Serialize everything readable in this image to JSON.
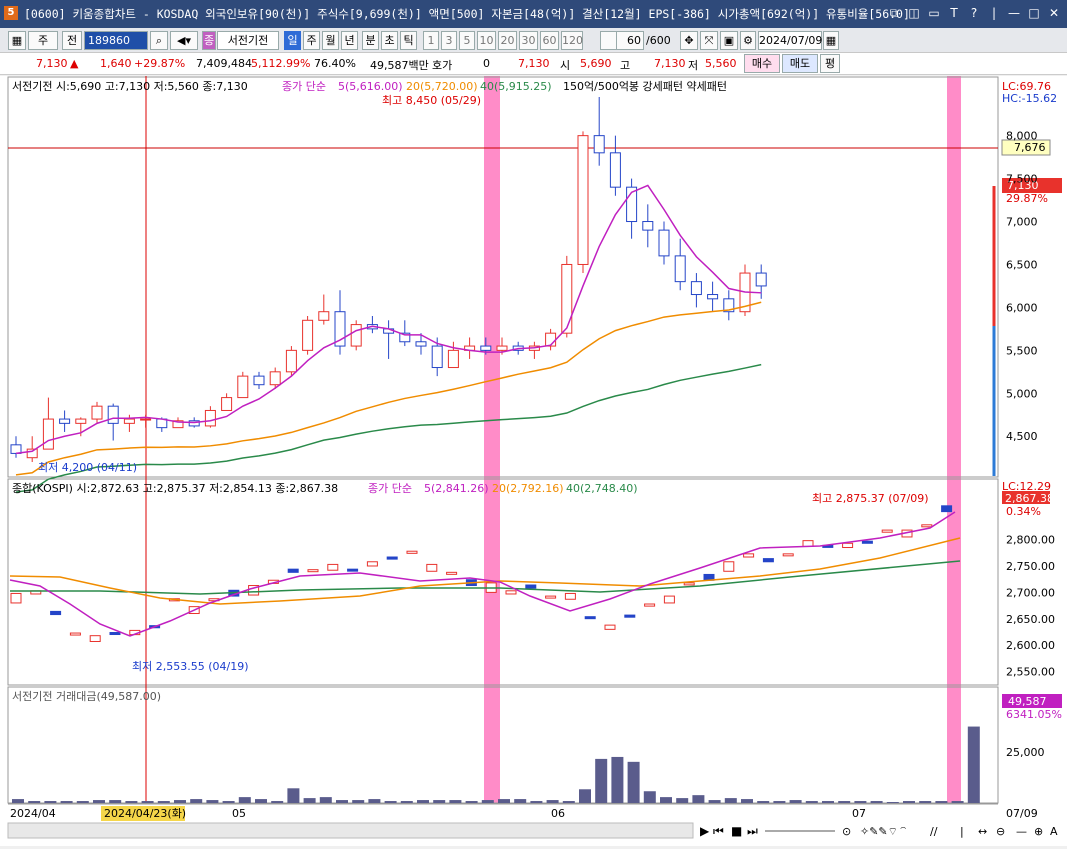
{
  "window": {
    "app_icon": "5",
    "title": "[0600] 키움종합차트 - KOSDAQ 외국인보유[90(천)] 주식수[9,699(천)] 액면[500] 자본금[48(억)] 결산[12월] EPS[-386] 시가총액[692(억)] 유통비율[56.0]",
    "buttons": [
      "⧉",
      "◫",
      "▭",
      "T",
      "?",
      "|",
      "—",
      "□",
      "✕"
    ]
  },
  "toolbar": {
    "market_sel": "주",
    "prev_label": "전",
    "code_value": "189860",
    "stock_name": "서전기전",
    "stock_badge": "종",
    "periods": [
      "일",
      "주",
      "월",
      "년",
      "분",
      "초",
      "틱"
    ],
    "intervals": [
      "1",
      "3",
      "5",
      "10",
      "20",
      "30",
      "60",
      "120"
    ],
    "count_value": "60",
    "count_total": "/600",
    "date_value": "2024/07/09"
  },
  "quote": {
    "price": "7,130",
    "arrow": "▲",
    "change": "1,640",
    "change_pct": "+29.87%",
    "volume": "7,409,484",
    "vol_ratio": "5,112.99%",
    "turnover": "76.40%",
    "amount": "49,587백만",
    "hoga_label": "호가",
    "hoga_value": "0",
    "cur": "7,130",
    "open_label": "시",
    "open": "5,690",
    "high_label": "고",
    "high": "7,130",
    "low_label": "저",
    "low": "5,560",
    "buy": "매수",
    "sell": "매도",
    "avg": "평"
  },
  "panel_price": {
    "info": "서전기전 시:5,690 고:7,130 저:5,560 종:7,130",
    "ma_title": "종가 단순",
    "ma5": "5(5,616.00)",
    "ma20": "20(5,720.00)",
    "ma40": "40(5,915.25)",
    "pattern": "150억/500억봉 강세패턴 약세패턴",
    "high_mark": "최고 8,450 (05/29)",
    "low_mark": "최저 4,200 (04/11)",
    "lc": "LC:69.76",
    "hc": "HC:-15.62",
    "hline_label": "7,676",
    "cur_label": "7,130",
    "cur_pct": "29.87%",
    "ticks": [
      "8,000",
      "7,500",
      "7,000",
      "6,500",
      "6,000",
      "5,500",
      "5,000",
      "4,500"
    ]
  },
  "panel_kospi": {
    "info": "종합(KOSPI) 시:2,872.63 고:2,875.37 저:2,854.13 종:2,867.38",
    "ma_title": "종가 단순",
    "ma5": "5(2,841.26)",
    "ma20": "20(2,792.16)",
    "ma40": "40(2,748.40)",
    "high_mark": "최고 2,875.37 (07/09)",
    "low_mark": "최저 2,553.55 (04/19)",
    "lc": "LC:12.29",
    "cur_label": "2,867.38",
    "cur_pct": "0.34%",
    "ticks": [
      "2,800.00",
      "2,750.00",
      "2,700.00",
      "2,650.00",
      "2,600.00",
      "2,550.00"
    ]
  },
  "panel_vol": {
    "info": "서전기전 거래대금(49,587.00)",
    "cur_label": "49,587",
    "cur_pct": "6341.05%",
    "ticks": [
      "25,000"
    ]
  },
  "xaxis": {
    "labels": [
      "2024/04",
      "05",
      "06",
      "07"
    ],
    "cursor_date": "2024/04/23(화)",
    "right_label": "07/09"
  },
  "colors": {
    "up": "#e8322c",
    "down": "#2445c8",
    "ma5": "#c020c0",
    "ma20": "#f08c00",
    "ma40": "#2a8a4a",
    "highlight": "#ff8cc8"
  },
  "chart_data": {
    "type": "candlestick",
    "series": [
      {
        "name": "서전기전",
        "ohlc": [
          [
            4400,
            4500,
            4250,
            4300
          ],
          [
            4250,
            4500,
            4200,
            4350
          ],
          [
            4350,
            4950,
            4350,
            4700
          ],
          [
            4700,
            4800,
            4550,
            4650
          ],
          [
            4650,
            4720,
            4500,
            4700
          ],
          [
            4700,
            4900,
            4650,
            4850
          ],
          [
            4850,
            4880,
            4450,
            4650
          ],
          [
            4650,
            4750,
            4550,
            4700
          ],
          [
            4700,
            4750,
            4600,
            4700
          ],
          [
            4700,
            4720,
            4550,
            4600
          ],
          [
            4600,
            4720,
            4600,
            4680
          ],
          [
            4680,
            4720,
            4600,
            4620
          ],
          [
            4620,
            4850,
            4600,
            4800
          ],
          [
            4800,
            5000,
            4800,
            4950
          ],
          [
            4950,
            5250,
            4950,
            5200
          ],
          [
            5200,
            5250,
            5050,
            5100
          ],
          [
            5100,
            5300,
            5050,
            5250
          ],
          [
            5250,
            5550,
            5200,
            5500
          ],
          [
            5500,
            5900,
            5450,
            5850
          ],
          [
            5850,
            6150,
            5800,
            5950
          ],
          [
            5950,
            6200,
            5450,
            5550
          ],
          [
            5550,
            5850,
            5500,
            5800
          ],
          [
            5800,
            5900,
            5700,
            5750
          ],
          [
            5750,
            5850,
            5400,
            5700
          ],
          [
            5700,
            5850,
            5550,
            5600
          ],
          [
            5600,
            5700,
            5450,
            5550
          ],
          [
            5550,
            5650,
            5200,
            5300
          ],
          [
            5300,
            5600,
            5300,
            5500
          ],
          [
            5500,
            5650,
            5400,
            5550
          ],
          [
            5550,
            5650,
            5450,
            5500
          ],
          [
            5500,
            5650,
            5450,
            5550
          ],
          [
            5550,
            5600,
            5450,
            5500
          ],
          [
            5500,
            5600,
            5400,
            5550
          ],
          [
            5550,
            5750,
            5500,
            5700
          ],
          [
            5700,
            6600,
            5650,
            6500
          ],
          [
            6500,
            8050,
            6400,
            8000
          ],
          [
            8000,
            8450,
            7650,
            7800
          ],
          [
            7800,
            8000,
            7300,
            7400
          ],
          [
            7400,
            7500,
            6800,
            7000
          ],
          [
            7000,
            7200,
            6700,
            6900
          ],
          [
            6900,
            7000,
            6500,
            6600
          ],
          [
            6600,
            6800,
            6200,
            6300
          ],
          [
            6300,
            6400,
            6000,
            6150
          ],
          [
            6150,
            6300,
            5950,
            6100
          ],
          [
            6100,
            6200,
            5850,
            5950
          ],
          [
            5950,
            6500,
            5900,
            6400
          ],
          [
            6400,
            6500,
            6100,
            6250
          ]
        ]
      }
    ],
    "kospi_ohlc_note": "KOSPI panel values range 2,550-2,875",
    "volume_highlights": [
      "2024/05/29",
      "2024/07/09"
    ]
  }
}
